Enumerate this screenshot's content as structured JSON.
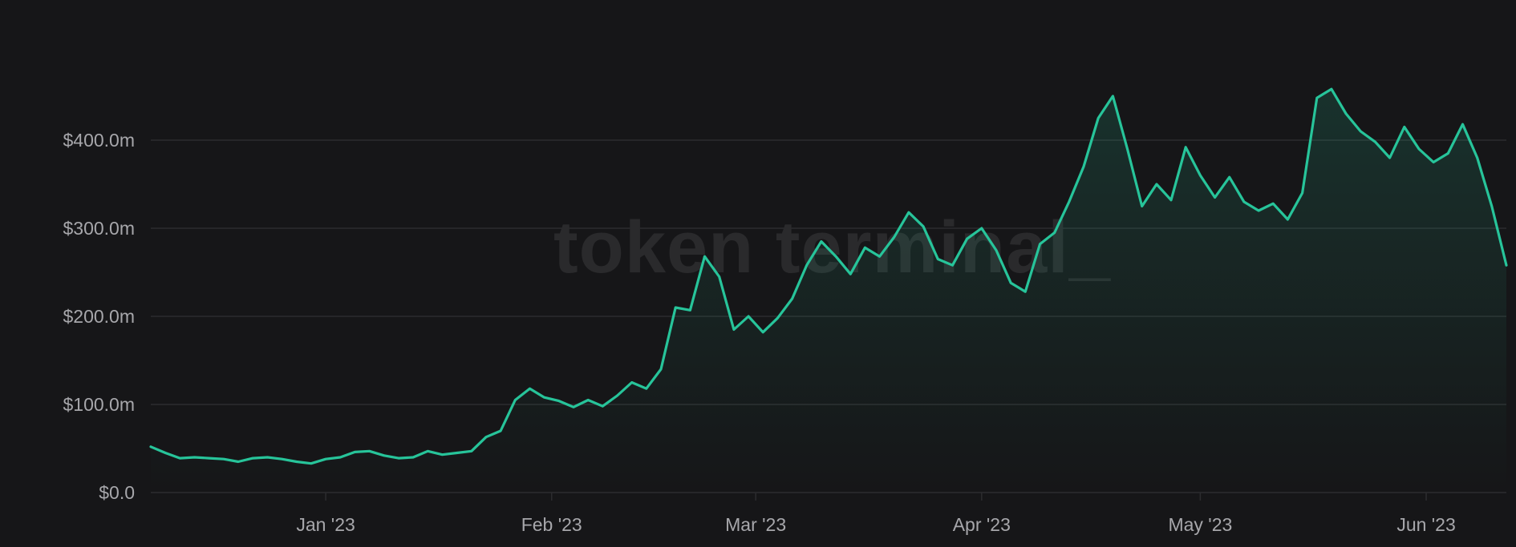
{
  "watermark": "token terminal_",
  "colors": {
    "background": "#161618",
    "line": "#27c49a",
    "grid": "#2c2c2f",
    "tick_text": "#a7a7ab"
  },
  "chart_data": {
    "type": "area",
    "title": "",
    "xlabel": "",
    "ylabel": "",
    "ylim": [
      0,
      450
    ],
    "xlim": [
      "2022-12-08",
      "2023-06-12"
    ],
    "y_ticks": [
      {
        "value": 0,
        "label": "$0.0"
      },
      {
        "value": 100,
        "label": "$100.0m"
      },
      {
        "value": 200,
        "label": "$200.0m"
      },
      {
        "value": 300,
        "label": "$300.0m"
      },
      {
        "value": 400,
        "label": "$400.0m"
      }
    ],
    "x_ticks": [
      {
        "date": "2023-01-01",
        "label": "Jan '23"
      },
      {
        "date": "2023-02-01",
        "label": "Feb '23"
      },
      {
        "date": "2023-03-01",
        "label": "Mar '23"
      },
      {
        "date": "2023-04-01",
        "label": "Apr '23"
      },
      {
        "date": "2023-05-01",
        "label": "May '23"
      },
      {
        "date": "2023-06-01",
        "label": "Jun '23"
      }
    ],
    "grid": true,
    "series": [
      {
        "points": [
          [
            "2022-12-08",
            52
          ],
          [
            "2022-12-10",
            45
          ],
          [
            "2022-12-12",
            39
          ],
          [
            "2022-12-14",
            40
          ],
          [
            "2022-12-16",
            39
          ],
          [
            "2022-12-18",
            38
          ],
          [
            "2022-12-20",
            35
          ],
          [
            "2022-12-22",
            39
          ],
          [
            "2022-12-24",
            40
          ],
          [
            "2022-12-26",
            38
          ],
          [
            "2022-12-28",
            35
          ],
          [
            "2022-12-30",
            33
          ],
          [
            "2023-01-01",
            38
          ],
          [
            "2023-01-03",
            40
          ],
          [
            "2023-01-05",
            46
          ],
          [
            "2023-01-07",
            47
          ],
          [
            "2023-01-09",
            42
          ],
          [
            "2023-01-11",
            39
          ],
          [
            "2023-01-13",
            40
          ],
          [
            "2023-01-15",
            47
          ],
          [
            "2023-01-17",
            43
          ],
          [
            "2023-01-19",
            45
          ],
          [
            "2023-01-21",
            47
          ],
          [
            "2023-01-23",
            63
          ],
          [
            "2023-01-25",
            70
          ],
          [
            "2023-01-27",
            105
          ],
          [
            "2023-01-29",
            118
          ],
          [
            "2023-01-31",
            108
          ],
          [
            "2023-02-02",
            104
          ],
          [
            "2023-02-04",
            97
          ],
          [
            "2023-02-06",
            105
          ],
          [
            "2023-02-08",
            98
          ],
          [
            "2023-02-10",
            110
          ],
          [
            "2023-02-12",
            125
          ],
          [
            "2023-02-14",
            118
          ],
          [
            "2023-02-16",
            140
          ],
          [
            "2023-02-18",
            210
          ],
          [
            "2023-02-20",
            207
          ],
          [
            "2023-02-22",
            268
          ],
          [
            "2023-02-24",
            245
          ],
          [
            "2023-02-26",
            185
          ],
          [
            "2023-02-28",
            200
          ],
          [
            "2023-03-02",
            182
          ],
          [
            "2023-03-04",
            198
          ],
          [
            "2023-03-06",
            220
          ],
          [
            "2023-03-08",
            258
          ],
          [
            "2023-03-10",
            285
          ],
          [
            "2023-03-12",
            268
          ],
          [
            "2023-03-14",
            248
          ],
          [
            "2023-03-16",
            278
          ],
          [
            "2023-03-18",
            268
          ],
          [
            "2023-03-20",
            290
          ],
          [
            "2023-03-22",
            318
          ],
          [
            "2023-03-24",
            302
          ],
          [
            "2023-03-26",
            265
          ],
          [
            "2023-03-28",
            258
          ],
          [
            "2023-03-30",
            288
          ],
          [
            "2023-04-01",
            300
          ],
          [
            "2023-04-03",
            275
          ],
          [
            "2023-04-05",
            238
          ],
          [
            "2023-04-07",
            228
          ],
          [
            "2023-04-09",
            282
          ],
          [
            "2023-04-11",
            295
          ],
          [
            "2023-04-13",
            330
          ],
          [
            "2023-04-15",
            370
          ],
          [
            "2023-04-17",
            425
          ],
          [
            "2023-04-19",
            450
          ],
          [
            "2023-04-21",
            390
          ],
          [
            "2023-04-23",
            325
          ],
          [
            "2023-04-25",
            350
          ],
          [
            "2023-04-27",
            332
          ],
          [
            "2023-04-29",
            392
          ],
          [
            "2023-05-01",
            360
          ],
          [
            "2023-05-03",
            335
          ],
          [
            "2023-05-05",
            358
          ],
          [
            "2023-05-07",
            330
          ],
          [
            "2023-05-09",
            320
          ],
          [
            "2023-05-11",
            328
          ],
          [
            "2023-05-13",
            310
          ],
          [
            "2023-05-15",
            340
          ],
          [
            "2023-05-17",
            448
          ],
          [
            "2023-05-19",
            458
          ],
          [
            "2023-05-21",
            430
          ],
          [
            "2023-05-23",
            410
          ],
          [
            "2023-05-25",
            398
          ],
          [
            "2023-05-27",
            380
          ],
          [
            "2023-05-29",
            415
          ],
          [
            "2023-05-31",
            390
          ],
          [
            "2023-06-02",
            375
          ],
          [
            "2023-06-04",
            385
          ],
          [
            "2023-06-06",
            418
          ],
          [
            "2023-06-08",
            380
          ],
          [
            "2023-06-10",
            325
          ],
          [
            "2023-06-12",
            258
          ]
        ]
      }
    ]
  }
}
